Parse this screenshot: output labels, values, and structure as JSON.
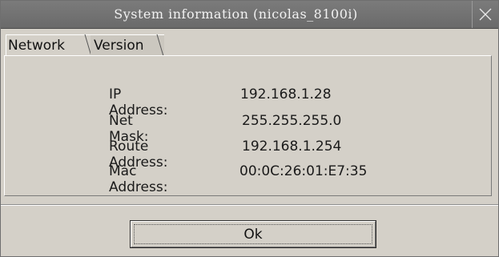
{
  "window": {
    "title": "System information (nicolas_8100i)",
    "close_icon": "close-icon"
  },
  "tabs": [
    {
      "label": "Network",
      "active": true
    },
    {
      "label": "Version",
      "active": false
    }
  ],
  "network": {
    "rows": [
      {
        "label": "IP Address:",
        "value": "192.168.1.28"
      },
      {
        "label": "Net Mask:",
        "value": "255.255.255.0"
      },
      {
        "label": "Route Address:",
        "value": "192.168.1.254"
      },
      {
        "label": "Mac Address:",
        "value": "00:0C:26:01:E7:35"
      }
    ]
  },
  "footer": {
    "ok_label": "Ok"
  }
}
